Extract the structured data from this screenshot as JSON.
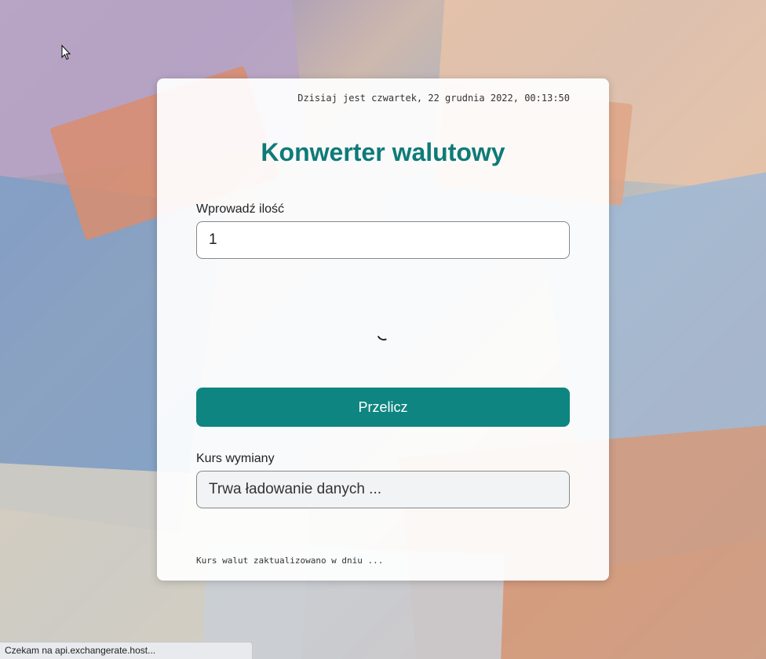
{
  "header": {
    "date_text": "Dzisiaj jest czwartek, 22 grudnia 2022, 00:13:50"
  },
  "converter": {
    "title": "Konwerter walutowy",
    "amount_label": "Wprowadź ilość",
    "amount_value": "1",
    "convert_button": "Przelicz",
    "rate_label": "Kurs wymiany",
    "rate_value": "Trwa ładowanie danych ...",
    "updated_note": "Kurs walut zaktualizowano w dniu ..."
  },
  "statusbar": {
    "text": "Czekam na api.exchangerate.host..."
  },
  "colors": {
    "accent": "#0e8580",
    "title": "#0e7b78"
  },
  "icons": {
    "cursor": "mouse-pointer-icon",
    "loading": "loading-spinner-icon"
  }
}
